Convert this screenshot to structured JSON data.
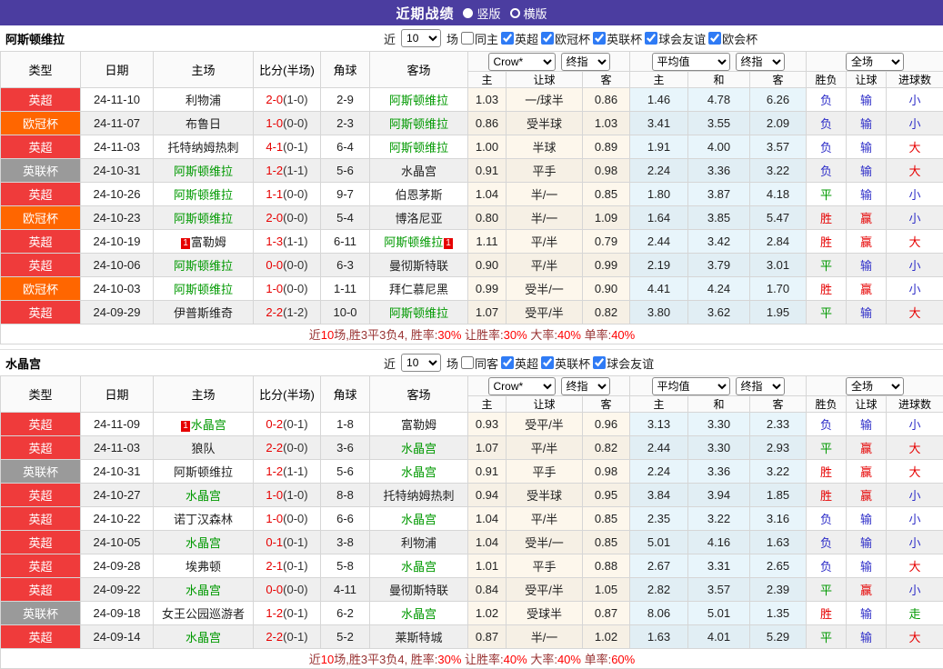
{
  "titlebar": {
    "title": "近期战绩",
    "options": [
      {
        "label": "竖版",
        "selected": true
      },
      {
        "label": "横版",
        "selected": false
      }
    ]
  },
  "table_header": {
    "type": "类型",
    "date": "日期",
    "home": "主场",
    "score": "比分(半场)",
    "corner": "角球",
    "away": "客场",
    "sel_crow": "Crow*",
    "sel_final": "终指",
    "sel_avg": "平均值",
    "sel_full": "全场",
    "sub_h_home": "主",
    "sub_h_line": "让球",
    "sub_h_away": "客",
    "sub_e_home": "主",
    "sub_e_draw": "和",
    "sub_e_away": "客",
    "sub_r_wl": "胜负",
    "sub_r_hcap": "让球",
    "sub_r_goals": "进球数"
  },
  "sections": [
    {
      "team": "阿斯顿维拉",
      "filter": {
        "near": "近",
        "count": "10",
        "unit": "场",
        "same_label": "同主",
        "same_checked": false,
        "leagues": [
          {
            "label": "英超",
            "checked": true
          },
          {
            "label": "欧冠杯",
            "checked": true
          },
          {
            "label": "英联杯",
            "checked": true
          },
          {
            "label": "球会友谊",
            "checked": true
          },
          {
            "label": "欧会杯",
            "checked": true
          }
        ]
      },
      "rows": [
        {
          "league": "英超",
          "lcolor": "red",
          "date": "24-11-10",
          "home": "利物浦",
          "homeGreen": false,
          "score": "2-0",
          "half": "(1-0)",
          "corner": "2-9",
          "away": "阿斯顿维拉",
          "awayGreen": true,
          "o1": "1.03",
          "o2": "一/球半",
          "o3": "0.86",
          "a1": "1.46",
          "a2": "4.78",
          "a3": "6.26",
          "w": "负",
          "wc": "blue",
          "h": "输",
          "hc": "blue",
          "g": "小",
          "gc": "blue"
        },
        {
          "league": "欧冠杯",
          "lcolor": "orange",
          "date": "24-11-07",
          "home": "布鲁日",
          "homeGreen": false,
          "score": "1-0",
          "half": "(0-0)",
          "corner": "2-3",
          "away": "阿斯顿维拉",
          "awayGreen": true,
          "o1": "0.86",
          "o2": "受半球",
          "o3": "1.03",
          "a1": "3.41",
          "a2": "3.55",
          "a3": "2.09",
          "w": "负",
          "wc": "blue",
          "h": "输",
          "hc": "blue",
          "g": "小",
          "gc": "blue"
        },
        {
          "league": "英超",
          "lcolor": "red",
          "date": "24-11-03",
          "home": "托特纳姆热刺",
          "homeGreen": false,
          "score": "4-1",
          "half": "(0-1)",
          "corner": "6-4",
          "away": "阿斯顿维拉",
          "awayGreen": true,
          "o1": "1.00",
          "o2": "半球",
          "o3": "0.89",
          "a1": "1.91",
          "a2": "4.00",
          "a3": "3.57",
          "w": "负",
          "wc": "blue",
          "h": "输",
          "hc": "blue",
          "g": "大",
          "gc": "red"
        },
        {
          "league": "英联杯",
          "lcolor": "gray",
          "date": "24-10-31",
          "home": "阿斯顿维拉",
          "homeGreen": true,
          "score": "1-2",
          "half": "(1-1)",
          "corner": "5-6",
          "away": "水晶宫",
          "awayGreen": false,
          "o1": "0.91",
          "o2": "平手",
          "o3": "0.98",
          "a1": "2.24",
          "a2": "3.36",
          "a3": "3.22",
          "w": "负",
          "wc": "blue",
          "h": "输",
          "hc": "blue",
          "g": "大",
          "gc": "red"
        },
        {
          "league": "英超",
          "lcolor": "red",
          "date": "24-10-26",
          "home": "阿斯顿维拉",
          "homeGreen": true,
          "score": "1-1",
          "half": "(0-0)",
          "corner": "9-7",
          "away": "伯恩茅斯",
          "awayGreen": false,
          "o1": "1.04",
          "o2": "半/一",
          "o3": "0.85",
          "a1": "1.80",
          "a2": "3.87",
          "a3": "4.18",
          "w": "平",
          "wc": "green",
          "h": "输",
          "hc": "blue",
          "g": "小",
          "gc": "blue"
        },
        {
          "league": "欧冠杯",
          "lcolor": "orange",
          "date": "24-10-23",
          "home": "阿斯顿维拉",
          "homeGreen": true,
          "score": "2-0",
          "half": "(0-0)",
          "corner": "5-4",
          "away": "博洛尼亚",
          "awayGreen": false,
          "o1": "0.80",
          "o2": "半/一",
          "o3": "1.09",
          "a1": "1.64",
          "a2": "3.85",
          "a3": "5.47",
          "w": "胜",
          "wc": "red",
          "h": "赢",
          "hc": "red",
          "g": "小",
          "gc": "blue"
        },
        {
          "league": "英超",
          "lcolor": "red",
          "date": "24-10-19",
          "home": "富勒姆",
          "homeGreen": false,
          "homeBadge": "1",
          "score": "1-3",
          "half": "(1-1)",
          "corner": "6-11",
          "away": "阿斯顿维拉",
          "awayGreen": true,
          "awayBadge": "1",
          "o1": "1.11",
          "o2": "平/半",
          "o3": "0.79",
          "a1": "2.44",
          "a2": "3.42",
          "a3": "2.84",
          "w": "胜",
          "wc": "red",
          "h": "赢",
          "hc": "red",
          "g": "大",
          "gc": "red"
        },
        {
          "league": "英超",
          "lcolor": "red",
          "date": "24-10-06",
          "home": "阿斯顿维拉",
          "homeGreen": true,
          "score": "0-0",
          "half": "(0-0)",
          "corner": "6-3",
          "away": "曼彻斯特联",
          "awayGreen": false,
          "o1": "0.90",
          "o2": "平/半",
          "o3": "0.99",
          "a1": "2.19",
          "a2": "3.79",
          "a3": "3.01",
          "w": "平",
          "wc": "green",
          "h": "输",
          "hc": "blue",
          "g": "小",
          "gc": "blue"
        },
        {
          "league": "欧冠杯",
          "lcolor": "orange",
          "date": "24-10-03",
          "home": "阿斯顿维拉",
          "homeGreen": true,
          "score": "1-0",
          "half": "(0-0)",
          "corner": "1-11",
          "away": "拜仁慕尼黑",
          "awayGreen": false,
          "o1": "0.99",
          "o2": "受半/一",
          "o3": "0.90",
          "a1": "4.41",
          "a2": "4.24",
          "a3": "1.70",
          "w": "胜",
          "wc": "red",
          "h": "赢",
          "hc": "red",
          "g": "小",
          "gc": "blue"
        },
        {
          "league": "英超",
          "lcolor": "red",
          "date": "24-09-29",
          "home": "伊普斯维奇",
          "homeGreen": false,
          "score": "2-2",
          "half": "(1-2)",
          "corner": "10-0",
          "away": "阿斯顿维拉",
          "awayGreen": true,
          "o1": "1.07",
          "o2": "受平/半",
          "o3": "0.82",
          "a1": "3.80",
          "a2": "3.62",
          "a3": "1.95",
          "w": "平",
          "wc": "green",
          "h": "输",
          "hc": "blue",
          "g": "大",
          "gc": "red"
        }
      ],
      "summary": {
        "near": "近",
        "count": "10",
        "mid": "场,胜3平3负4, 胜率:",
        "win_rate": "30%",
        "l2": " 让胜率:",
        "handicap_rate": "30%",
        "l3": " 大率:",
        "big_rate": "40%",
        "l4": " 单率:",
        "single_rate": "40%"
      }
    },
    {
      "team": "水晶宫",
      "filter": {
        "near": "近",
        "count": "10",
        "unit": "场",
        "same_label": "同客",
        "same_checked": false,
        "leagues": [
          {
            "label": "英超",
            "checked": true
          },
          {
            "label": "英联杯",
            "checked": true
          },
          {
            "label": "球会友谊",
            "checked": true
          }
        ]
      },
      "rows": [
        {
          "league": "英超",
          "lcolor": "red",
          "date": "24-11-09",
          "home": "水晶宫",
          "homeGreen": true,
          "homeBadge": "1",
          "score": "0-2",
          "half": "(0-1)",
          "corner": "1-8",
          "away": "富勒姆",
          "awayGreen": false,
          "o1": "0.93",
          "o2": "受平/半",
          "o3": "0.96",
          "a1": "3.13",
          "a2": "3.30",
          "a3": "2.33",
          "w": "负",
          "wc": "blue",
          "h": "输",
          "hc": "blue",
          "g": "小",
          "gc": "blue"
        },
        {
          "league": "英超",
          "lcolor": "red",
          "date": "24-11-03",
          "home": "狼队",
          "homeGreen": false,
          "score": "2-2",
          "half": "(0-0)",
          "corner": "3-6",
          "away": "水晶宫",
          "awayGreen": true,
          "o1": "1.07",
          "o2": "平/半",
          "o3": "0.82",
          "a1": "2.44",
          "a2": "3.30",
          "a3": "2.93",
          "w": "平",
          "wc": "green",
          "h": "赢",
          "hc": "red",
          "g": "大",
          "gc": "red"
        },
        {
          "league": "英联杯",
          "lcolor": "gray",
          "date": "24-10-31",
          "home": "阿斯顿维拉",
          "homeGreen": false,
          "score": "1-2",
          "half": "(1-1)",
          "corner": "5-6",
          "away": "水晶宫",
          "awayGreen": true,
          "o1": "0.91",
          "o2": "平手",
          "o3": "0.98",
          "a1": "2.24",
          "a2": "3.36",
          "a3": "3.22",
          "w": "胜",
          "wc": "red",
          "h": "赢",
          "hc": "red",
          "g": "大",
          "gc": "red"
        },
        {
          "league": "英超",
          "lcolor": "red",
          "date": "24-10-27",
          "home": "水晶宫",
          "homeGreen": true,
          "score": "1-0",
          "half": "(1-0)",
          "corner": "8-8",
          "away": "托特纳姆热刺",
          "awayGreen": false,
          "o1": "0.94",
          "o2": "受半球",
          "o3": "0.95",
          "a1": "3.84",
          "a2": "3.94",
          "a3": "1.85",
          "w": "胜",
          "wc": "red",
          "h": "赢",
          "hc": "red",
          "g": "小",
          "gc": "blue"
        },
        {
          "league": "英超",
          "lcolor": "red",
          "date": "24-10-22",
          "home": "诺丁汉森林",
          "homeGreen": false,
          "score": "1-0",
          "half": "(0-0)",
          "corner": "6-6",
          "away": "水晶宫",
          "awayGreen": true,
          "o1": "1.04",
          "o2": "平/半",
          "o3": "0.85",
          "a1": "2.35",
          "a2": "3.22",
          "a3": "3.16",
          "w": "负",
          "wc": "blue",
          "h": "输",
          "hc": "blue",
          "g": "小",
          "gc": "blue"
        },
        {
          "league": "英超",
          "lcolor": "red",
          "date": "24-10-05",
          "home": "水晶宫",
          "homeGreen": true,
          "score": "0-1",
          "half": "(0-1)",
          "corner": "3-8",
          "away": "利物浦",
          "awayGreen": false,
          "o1": "1.04",
          "o2": "受半/一",
          "o3": "0.85",
          "a1": "5.01",
          "a2": "4.16",
          "a3": "1.63",
          "w": "负",
          "wc": "blue",
          "h": "输",
          "hc": "blue",
          "g": "小",
          "gc": "blue"
        },
        {
          "league": "英超",
          "lcolor": "red",
          "date": "24-09-28",
          "home": "埃弗顿",
          "homeGreen": false,
          "score": "2-1",
          "half": "(0-1)",
          "corner": "5-8",
          "away": "水晶宫",
          "awayGreen": true,
          "o1": "1.01",
          "o2": "平手",
          "o3": "0.88",
          "a1": "2.67",
          "a2": "3.31",
          "a3": "2.65",
          "w": "负",
          "wc": "blue",
          "h": "输",
          "hc": "blue",
          "g": "大",
          "gc": "red"
        },
        {
          "league": "英超",
          "lcolor": "red",
          "date": "24-09-22",
          "home": "水晶宫",
          "homeGreen": true,
          "score": "0-0",
          "half": "(0-0)",
          "corner": "4-11",
          "away": "曼彻斯特联",
          "awayGreen": false,
          "o1": "0.84",
          "o2": "受平/半",
          "o3": "1.05",
          "a1": "2.82",
          "a2": "3.57",
          "a3": "2.39",
          "w": "平",
          "wc": "green",
          "h": "赢",
          "hc": "red",
          "g": "小",
          "gc": "blue"
        },
        {
          "league": "英联杯",
          "lcolor": "gray",
          "date": "24-09-18",
          "home": "女王公园巡游者",
          "homeGreen": false,
          "score": "1-2",
          "half": "(0-1)",
          "corner": "6-2",
          "away": "水晶宫",
          "awayGreen": true,
          "o1": "1.02",
          "o2": "受球半",
          "o3": "0.87",
          "a1": "8.06",
          "a2": "5.01",
          "a3": "1.35",
          "w": "胜",
          "wc": "red",
          "h": "输",
          "hc": "blue",
          "g": "走",
          "gc": "green"
        },
        {
          "league": "英超",
          "lcolor": "red",
          "date": "24-09-14",
          "home": "水晶宫",
          "homeGreen": true,
          "score": "2-2",
          "half": "(0-1)",
          "corner": "5-2",
          "away": "莱斯特城",
          "awayGreen": false,
          "o1": "0.87",
          "o2": "半/一",
          "o3": "1.02",
          "a1": "1.63",
          "a2": "4.01",
          "a3": "5.29",
          "w": "平",
          "wc": "green",
          "h": "输",
          "hc": "blue",
          "g": "大",
          "gc": "red"
        }
      ],
      "summary": {
        "near": "近",
        "count": "10",
        "mid": "场,胜3平3负4, 胜率:",
        "win_rate": "30%",
        "l2": " 让胜率:",
        "handicap_rate": "40%",
        "l3": " 大率:",
        "big_rate": "40%",
        "l4": " 单率:",
        "single_rate": "60%"
      }
    }
  ]
}
